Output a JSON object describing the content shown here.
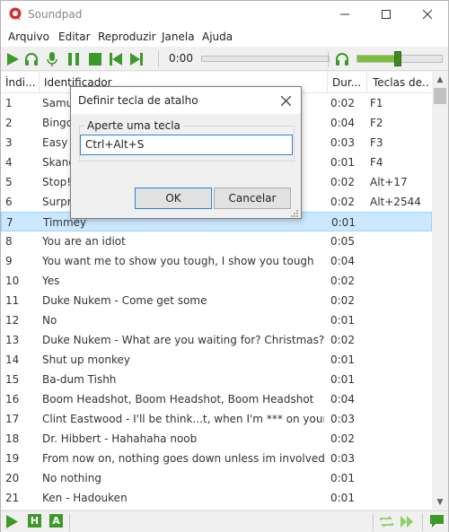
{
  "window": {
    "title": "Soundpad"
  },
  "menu": [
    "Arquivo",
    "Editar",
    "Reproduzir",
    "Janela",
    "Ajuda"
  ],
  "toolbar": {
    "time": "0:00",
    "volume_level": 0.48,
    "icons": [
      "play-icon",
      "headphones-icon",
      "microphone-icon",
      "pause-icon",
      "stop-icon",
      "previous-icon",
      "next-icon",
      "volume-headphones-icon"
    ]
  },
  "colors": {
    "accent_green": "#3d9a2a",
    "selection": "#cce8ff",
    "focus_blue": "#2e83d6",
    "brand_red": "#d32f2f"
  },
  "list": {
    "headers": {
      "index": "Índi...",
      "name": "Identificador",
      "duration": "Dur...",
      "hotkey": "Teclas de..."
    },
    "rows": [
      {
        "index": "1",
        "name": "Samu",
        "duration": "0:02",
        "hotkey": "F1"
      },
      {
        "index": "2",
        "name": "Bingo",
        "duration": "0:04",
        "hotkey": "F2"
      },
      {
        "index": "3",
        "name": "Easy p",
        "duration": "0:03",
        "hotkey": "F3"
      },
      {
        "index": "4",
        "name": "Skano",
        "duration": "0:01",
        "hotkey": "F4"
      },
      {
        "index": "5",
        "name": "Stop!",
        "duration": "0:02",
        "hotkey": "Alt+17"
      },
      {
        "index": "6",
        "name": "Surpr",
        "duration": "0:02",
        "hotkey": "Alt+2544"
      },
      {
        "index": "7",
        "name": "Timmey",
        "duration": "0:01",
        "hotkey": "",
        "selected": true
      },
      {
        "index": "8",
        "name": "You are an idiot",
        "duration": "0:05",
        "hotkey": ""
      },
      {
        "index": "9",
        "name": "You want me to show you tough, I show you tough",
        "duration": "0:04",
        "hotkey": ""
      },
      {
        "index": "10",
        "name": "Yes",
        "duration": "0:02",
        "hotkey": ""
      },
      {
        "index": "11",
        "name": "Duke Nukem - Come get some",
        "duration": "0:02",
        "hotkey": ""
      },
      {
        "index": "12",
        "name": "No",
        "duration": "0:01",
        "hotkey": ""
      },
      {
        "index": "13",
        "name": "Duke Nukem - What are you waiting for? Christmas?",
        "duration": "0:02",
        "hotkey": ""
      },
      {
        "index": "14",
        "name": "Shut up monkey",
        "duration": "0:01",
        "hotkey": ""
      },
      {
        "index": "15",
        "name": "Ba-dum Tishh",
        "duration": "0:01",
        "hotkey": ""
      },
      {
        "index": "16",
        "name": "Boom Headshot, Boom Headshot, Boom Headshot",
        "duration": "0:04",
        "hotkey": ""
      },
      {
        "index": "17",
        "name": "Clint Eastwood - I'll be think...t, when I'm *** on your grave",
        "duration": "0:03",
        "hotkey": ""
      },
      {
        "index": "18",
        "name": "Dr. Hibbert - Hahahaha noob",
        "duration": "0:02",
        "hotkey": ""
      },
      {
        "index": "19",
        "name": "From now on, nothing goes down unless im involved",
        "duration": "0:03",
        "hotkey": ""
      },
      {
        "index": "20",
        "name": "No nothing",
        "duration": "0:01",
        "hotkey": ""
      },
      {
        "index": "21",
        "name": "Ken - Hadouken",
        "duration": "0:01",
        "hotkey": ""
      }
    ]
  },
  "bottombar": {
    "h_label": "H",
    "a_label": "A"
  },
  "dialog": {
    "title": "Definir tecla de atalho",
    "group_label": "Aperte uma tecla",
    "input_value": "Ctrl+Alt+S",
    "ok_label": "OK",
    "cancel_label": "Cancelar"
  }
}
